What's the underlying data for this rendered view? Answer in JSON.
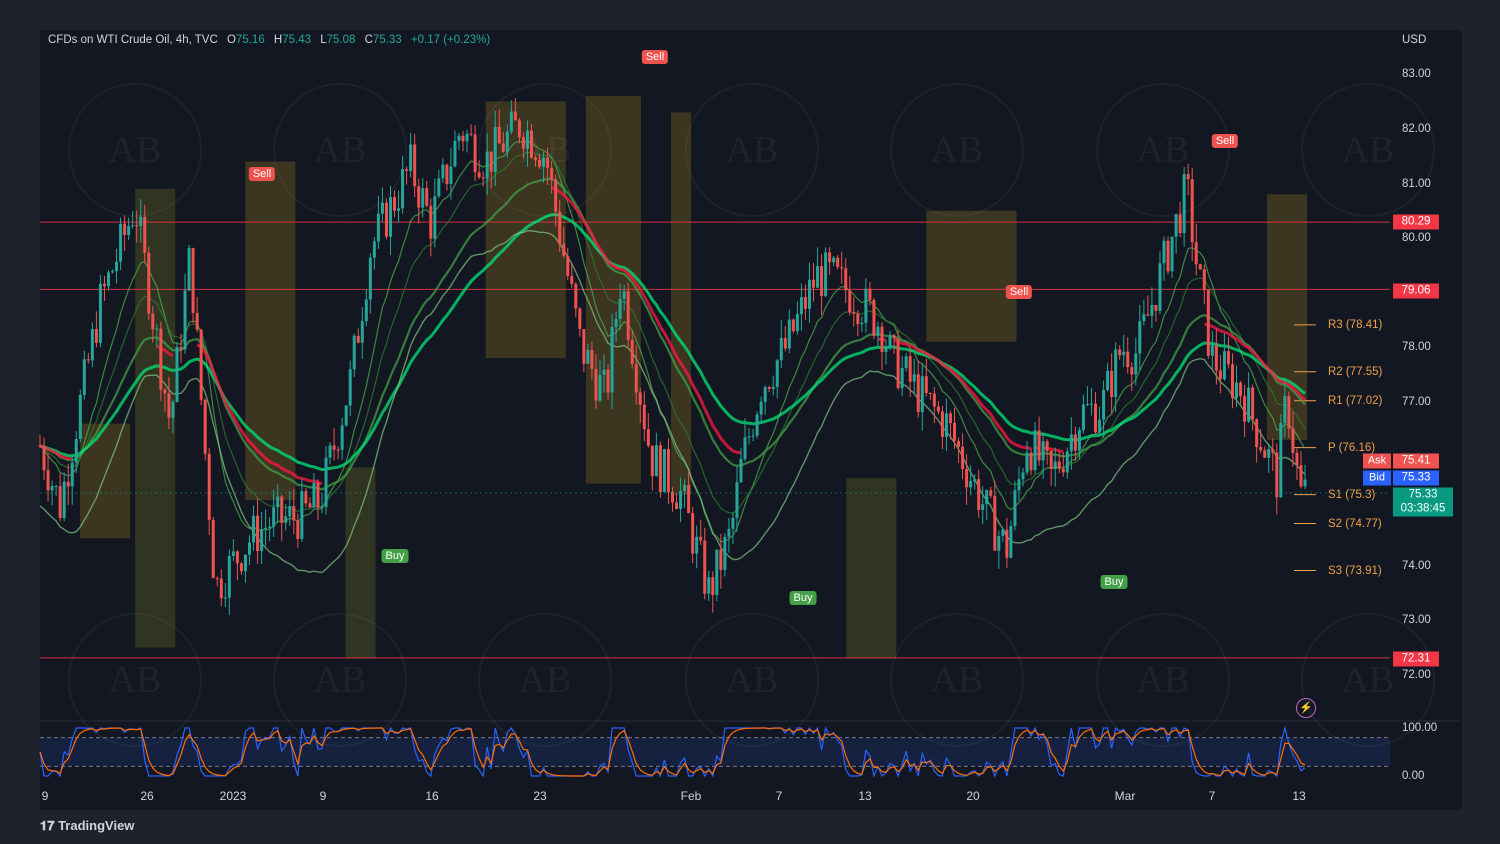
{
  "header": {
    "symbol": "CFDs on WTI Crude Oil, 4h, TVC",
    "o_label": "O",
    "o_value": "75.16",
    "h_label": "H",
    "h_value": "75.43",
    "l_label": "L",
    "l_value": "75.08",
    "c_label": "C",
    "c_value": "75.33",
    "change": "+0.17 (+0.23%)"
  },
  "currency": "USD",
  "logo": "TradingView",
  "colors": {
    "up": "#26a69a",
    "down": "#ef5350",
    "background": "#131722",
    "pivot": "#f0a04b",
    "last_price": "#089981",
    "ask": "#ef5350",
    "bid": "#2962ff"
  },
  "price_badges": {
    "level_1": "80.29",
    "level_2": "79.06",
    "level_3": "72.31",
    "ask_label": "Ask",
    "ask": "75.41",
    "bid_label": "Bid",
    "bid": "75.33",
    "last": "75.33",
    "countdown": "03:38:45"
  },
  "pivots": [
    "R3 (78.41)",
    "R2 (77.55)",
    "R1 (77.02)",
    "P (76.16)",
    "S1 (75.3)",
    "S2 (74.77)",
    "S3 (73.91)"
  ],
  "signals": [
    {
      "type": "sell",
      "label": "Sell"
    },
    {
      "type": "sell",
      "label": "Sell"
    },
    {
      "type": "sell",
      "label": "Sell"
    },
    {
      "type": "sell",
      "label": "Sell"
    },
    {
      "type": "buy",
      "label": "Buy"
    },
    {
      "type": "buy",
      "label": "Buy"
    },
    {
      "type": "buy",
      "label": "Buy"
    }
  ],
  "chart_data": {
    "type": "candlestick",
    "title": "CFDs on WTI Crude Oil, 4h, TVC",
    "y_ticks": [
      "83.00",
      "82.00",
      "81.00",
      "80.00",
      "78.00",
      "77.00",
      "74.00",
      "73.00",
      "72.00"
    ],
    "ylim": [
      71.0,
      83.5
    ],
    "x_ticks": [
      "9",
      "26",
      "2023",
      "9",
      "16",
      "23",
      "Feb",
      "7",
      "13",
      "20",
      "Mar",
      "7",
      "13"
    ],
    "horizontal_levels": [
      80.29,
      79.06,
      72.31
    ],
    "pivot_levels": [
      78.41,
      77.55,
      77.02,
      76.16,
      75.3,
      74.77,
      73.91
    ],
    "anchors": [
      [
        0,
        76.2
      ],
      [
        20,
        75.1
      ],
      [
        60,
        78.8
      ],
      [
        95,
        80.6
      ],
      [
        130,
        76.6
      ],
      [
        150,
        79.7
      ],
      [
        175,
        73.6
      ],
      [
        210,
        74.5
      ],
      [
        230,
        74.8
      ],
      [
        260,
        74.9
      ],
      [
        280,
        75.2
      ],
      [
        310,
        77.4
      ],
      [
        330,
        79.8
      ],
      [
        370,
        81.3
      ],
      [
        390,
        80.3
      ],
      [
        420,
        82.0
      ],
      [
        445,
        81.4
      ],
      [
        480,
        82.1
      ],
      [
        505,
        81.5
      ],
      [
        540,
        78.0
      ],
      [
        565,
        77.1
      ],
      [
        580,
        79.3
      ],
      [
        610,
        76.0
      ],
      [
        640,
        75.3
      ],
      [
        668,
        73.5
      ],
      [
        690,
        74.6
      ],
      [
        700,
        75.8
      ],
      [
        720,
        77.3
      ],
      [
        745,
        78.0
      ],
      [
        775,
        79.3
      ],
      [
        790,
        79.3
      ],
      [
        815,
        78.9
      ],
      [
        840,
        78.4
      ],
      [
        850,
        77.8
      ],
      [
        880,
        77.1
      ],
      [
        905,
        76.6
      ],
      [
        945,
        75.0
      ],
      [
        965,
        74.3
      ],
      [
        985,
        76.3
      ],
      [
        1010,
        75.6
      ],
      [
        1040,
        76.8
      ],
      [
        1060,
        76.9
      ],
      [
        1080,
        78.0
      ],
      [
        1095,
        77.9
      ],
      [
        1120,
        79.4
      ],
      [
        1145,
        80.9
      ],
      [
        1155,
        79.5
      ],
      [
        1170,
        77.8
      ],
      [
        1200,
        77.2
      ],
      [
        1235,
        75.6
      ],
      [
        1245,
        77.1
      ],
      [
        1258,
        75.3
      ],
      [
        1263,
        75.33
      ]
    ],
    "x_range": [
      0,
      1263
    ],
    "stochastic": {
      "ylim": [
        0,
        100
      ],
      "y_ticks": [
        "100.00",
        "0.00"
      ],
      "bands": [
        80,
        20
      ]
    },
    "grid": false,
    "legend": "none"
  },
  "watermark": "AB"
}
